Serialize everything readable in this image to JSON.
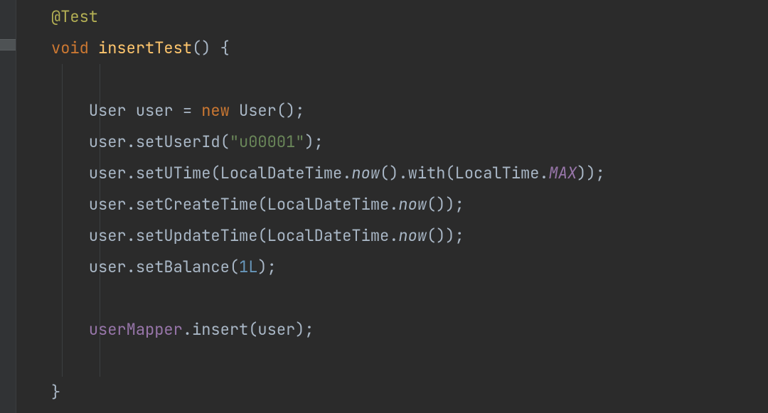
{
  "code": {
    "annotation": "@Test",
    "kw_void": "void",
    "method_name": "insertTest",
    "decl_rest": "() {",
    "l_user_decl_a": "User user = ",
    "kw_new": "new",
    "l_user_decl_b": " User();",
    "l_setUserId_a": "user.setUserId(",
    "str_u00001": "\"u00001\"",
    "close_stmt": ");",
    "l_setUTime_a": "user.setUTime(LocalDateTime.",
    "now": "now",
    "l_setUTime_b": "().with(LocalTime.",
    "MAX": "MAX",
    "close_stmt2": "));",
    "l_setCreate_a": "user.setCreateTime(LocalDateTime.",
    "paren_close_stmt": "());",
    "l_setUpdate_a": "user.setUpdateTime(LocalDateTime.",
    "l_setBalance_a": "user.setBalance(",
    "num_1L": "1L",
    "field_userMapper": "userMapper",
    "l_insert_b": ".insert(user);",
    "brace_close": "}"
  }
}
